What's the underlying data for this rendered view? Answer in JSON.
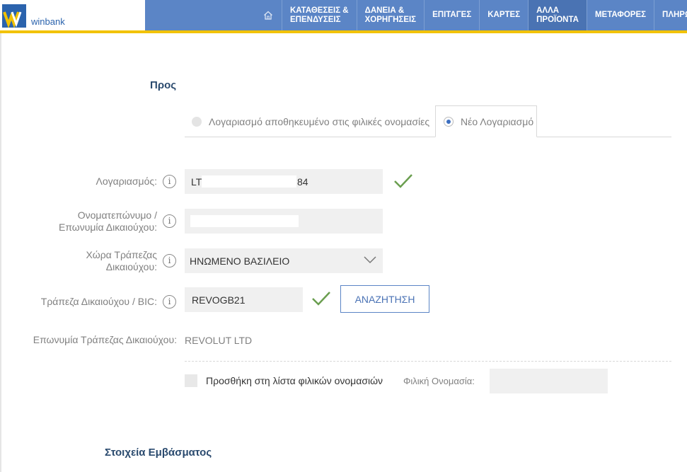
{
  "brand": {
    "name": "winbank"
  },
  "nav": {
    "items": [
      {
        "label": "ΚΑΤΑΘΕΣΕΙΣ &\nΕΠΕΝΔΥΣΕΙΣ"
      },
      {
        "label": "ΔΑΝΕΙΑ &\nΧΟΡΗΓΗΣΕΙΣ"
      },
      {
        "label": "ΕΠΙΤΑΓΕΣ"
      },
      {
        "label": "ΚΑΡΤΕΣ"
      },
      {
        "label": "ΑΛΛΑ\nΠΡΟΪΟΝΤΑ",
        "active": true
      },
      {
        "label": "ΜΕΤΑΦΟΡΕΣ"
      },
      {
        "label": "ΠΛΗΡΩ"
      }
    ]
  },
  "form": {
    "section_to": "Προς",
    "tabs": {
      "saved": "Λογαριασμό αποθηκευμένο στις φιλικές ονομασίες",
      "new": "Νέο Λογαριασμό"
    },
    "account": {
      "label": "Λογαριασμός:",
      "prefix": "LT",
      "suffix": "84"
    },
    "beneficiary_name": {
      "label": "Ονοματεπώνυμο /\nΕπωνυμία Δικαιούχου:"
    },
    "bank_country": {
      "label": "Χώρα Τράπεζας\nΔικαιούχου:",
      "value": "ΗΝΩΜΕΝΟ ΒΑΣΙΛΕΙΟ"
    },
    "bic": {
      "label": "Τράπεζα Δικαιούχου / BIC:",
      "value": "REVOGB21",
      "button": "ΑΝΑΖΗΤΗΣΗ"
    },
    "bank_name": {
      "label": "Επωνυμία Τράπεζας Δικαιούχου:",
      "value": "REVOLUT LTD"
    },
    "add_to_list": "Προσθήκη στη λίστα φιλικών ονομασιών",
    "friendly_name": {
      "label": "Φιλική Ονομασία:",
      "value": ""
    },
    "section_remittance": "Στοιχεία Εμβάσματος"
  },
  "colors": {
    "nav_bg": "#5b85c6",
    "accent_yellow": "#f2c200",
    "check_green": "#6a9e4f",
    "title_navy": "#2a4a6e"
  }
}
